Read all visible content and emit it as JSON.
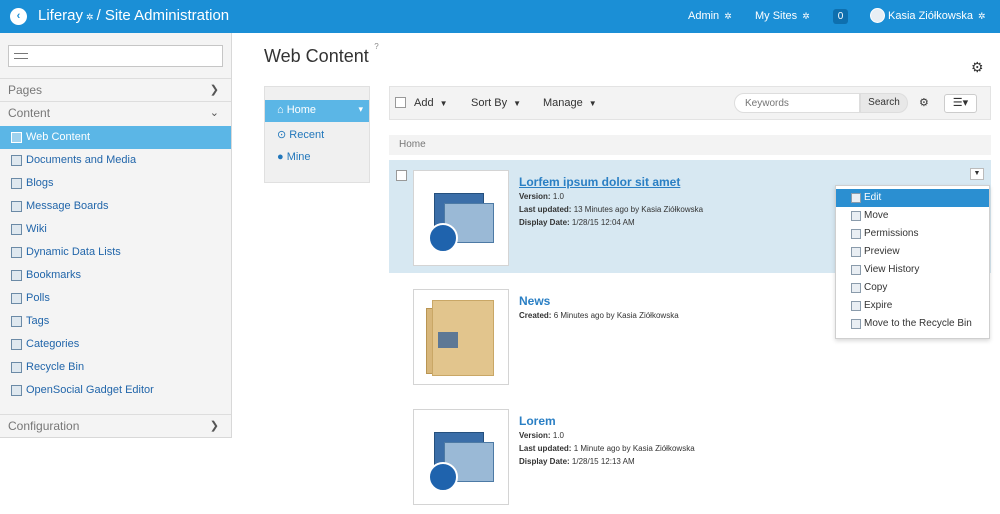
{
  "topbar": {
    "brand": "Liferay",
    "separator": "/",
    "section": "Site Administration",
    "admin": "Admin",
    "my_sites": "My Sites",
    "notifications_count": "0",
    "user_name": "Kasia Ziółkowska",
    "color": "#1b8fd6"
  },
  "sidebar": {
    "search_placeholder": "",
    "pages": "Pages",
    "content": "Content",
    "content_items": [
      {
        "label": "Web Content"
      },
      {
        "label": "Documents and Media"
      },
      {
        "label": "Blogs"
      },
      {
        "label": "Message Boards"
      },
      {
        "label": "Wiki"
      },
      {
        "label": "Dynamic Data Lists"
      },
      {
        "label": "Bookmarks"
      },
      {
        "label": "Polls"
      },
      {
        "label": "Tags"
      },
      {
        "label": "Categories"
      },
      {
        "label": "Recycle Bin"
      },
      {
        "label": "OpenSocial Gadget Editor"
      }
    ],
    "configuration": "Configuration",
    "active_color": "#5bb6e6"
  },
  "main": {
    "title": "Web Content",
    "subnav": [
      {
        "label": "Home"
      },
      {
        "label": "Recent"
      },
      {
        "label": "Mine"
      }
    ],
    "toolbar": {
      "add": "Add",
      "sort_by": "Sort By",
      "manage": "Manage",
      "keywords_placeholder": "Keywords",
      "search": "Search"
    },
    "breadcrumb": "Home",
    "entries": [
      {
        "title": "Lorfem ipsum dolor sit amet",
        "version_label": "Version:",
        "version": "1.0",
        "updated_label": "Last updated:",
        "updated": "13 Minutes ago by Kasia Ziółkowska",
        "display_label": "Display Date:",
        "display": "1/28/15 12:04 AM"
      },
      {
        "title": "News",
        "created_label": "Created:",
        "created": "6 Minutes ago by Kasia Ziółkowska"
      },
      {
        "title": "Lorem",
        "version_label": "Version:",
        "version": "1.0",
        "updated_label": "Last updated:",
        "updated": "1 Minute ago by Kasia Ziółkowska",
        "display_label": "Display Date:",
        "display": "1/28/15 12:13 AM"
      }
    ],
    "actions_menu": [
      {
        "label": "Edit",
        "icon": "edit-icon"
      },
      {
        "label": "Move",
        "icon": "move-icon"
      },
      {
        "label": "Permissions",
        "icon": "permissions-icon"
      },
      {
        "label": "Preview",
        "icon": "preview-icon"
      },
      {
        "label": "View History",
        "icon": "history-icon"
      },
      {
        "label": "Copy",
        "icon": "copy-icon"
      },
      {
        "label": "Expire",
        "icon": "expire-icon"
      },
      {
        "label": "Move to the Recycle Bin",
        "icon": "recycle-bin-icon"
      }
    ]
  }
}
